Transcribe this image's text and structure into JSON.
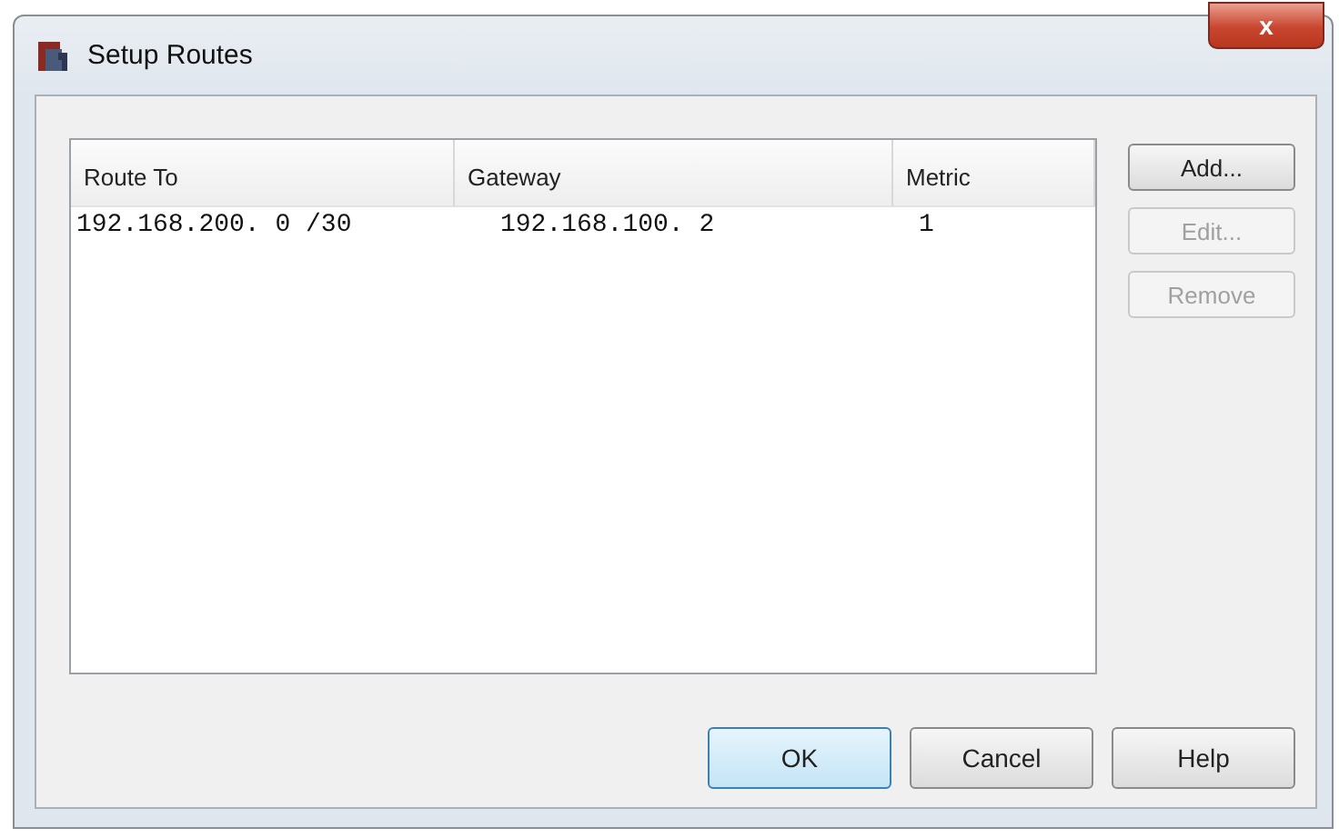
{
  "window": {
    "title": "Setup Routes",
    "close": "x"
  },
  "table": {
    "columns": [
      "Route To",
      "Gateway",
      "Metric"
    ],
    "rows": [
      {
        "cells": [
          "192.168.200. 0 /30",
          "192.168.100. 2",
          "1"
        ]
      }
    ]
  },
  "side_buttons": [
    {
      "label": "Add...",
      "disabled": false
    },
    {
      "label": "Edit...",
      "disabled": true
    },
    {
      "label": "Remove",
      "disabled": true
    }
  ],
  "buttons": [
    {
      "label": "OK",
      "default": true
    },
    {
      "label": "Cancel",
      "default": false
    },
    {
      "label": "Help",
      "default": false
    }
  ]
}
